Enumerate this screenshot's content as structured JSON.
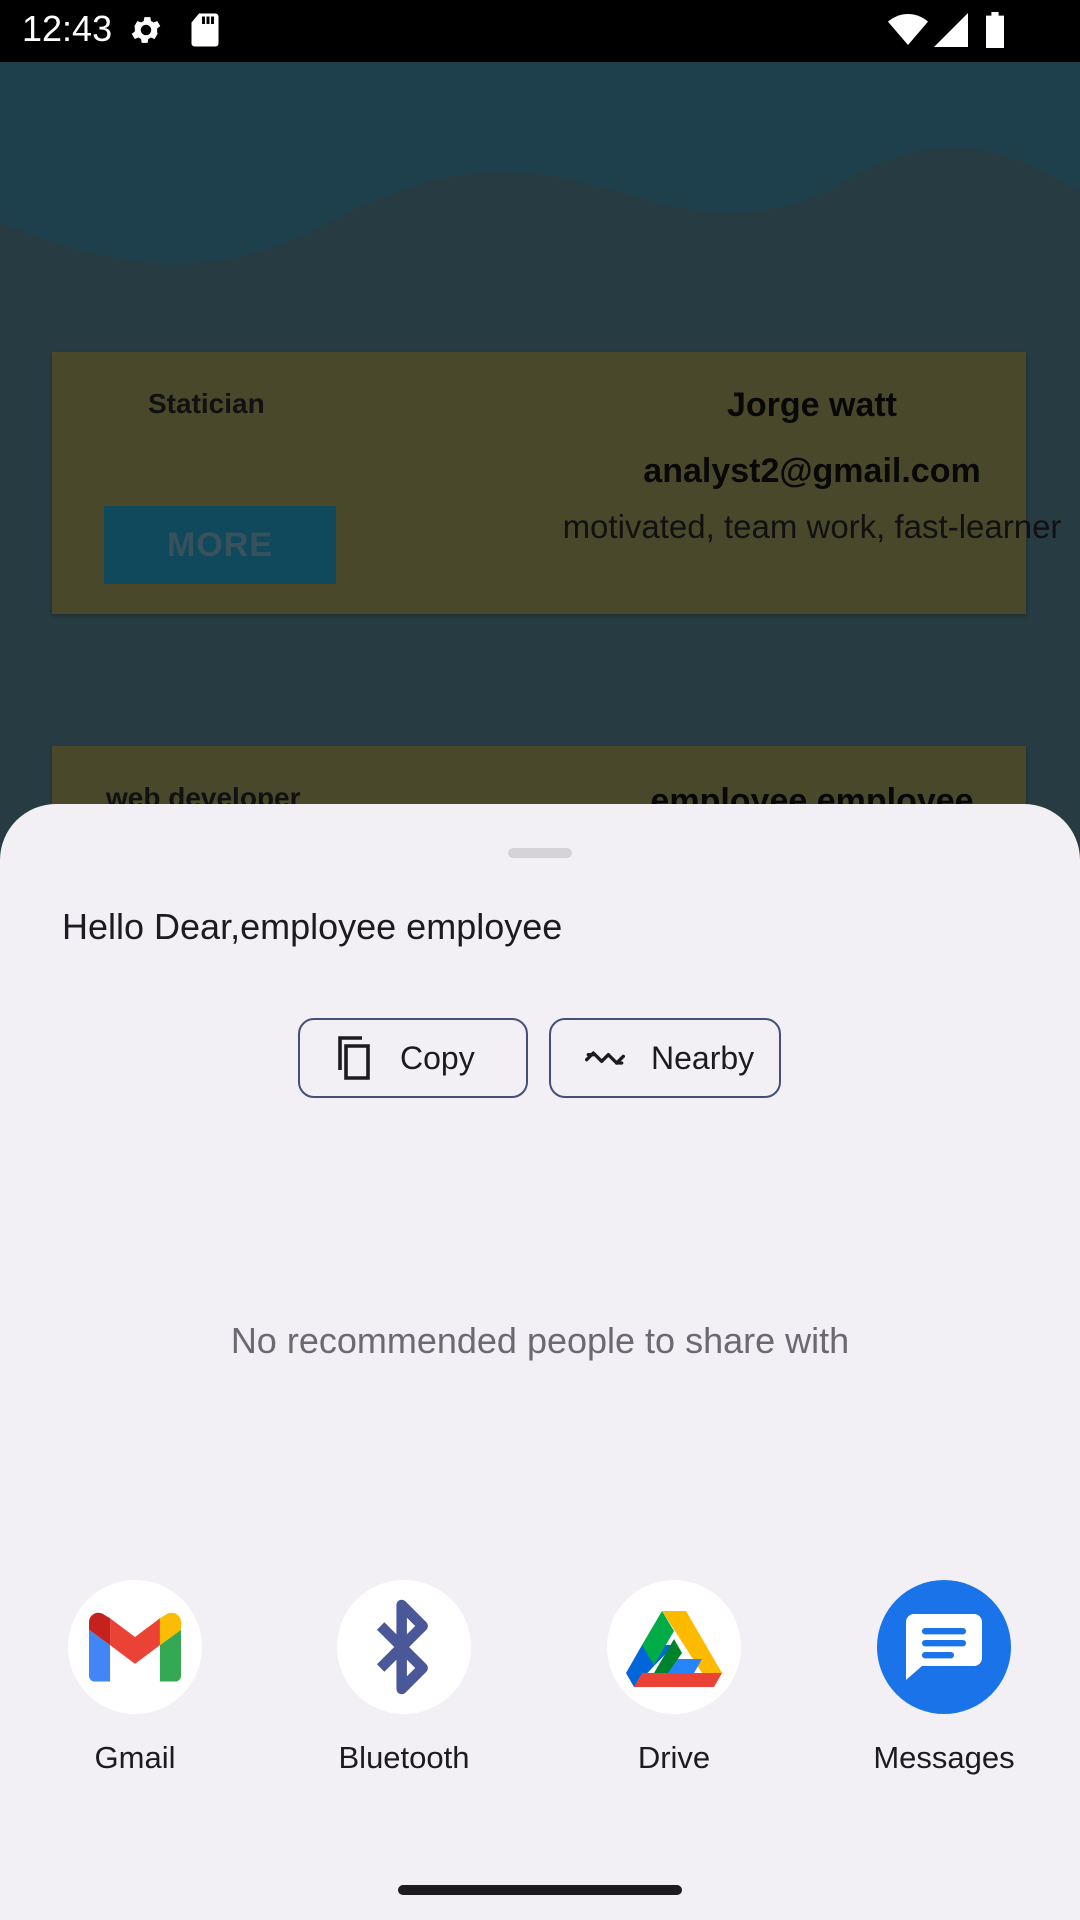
{
  "status_bar": {
    "time": "12:43",
    "icons": [
      "gear-icon",
      "sd-card-icon",
      "wifi-icon",
      "signal-icon",
      "battery-icon"
    ]
  },
  "background_app": {
    "cards": [
      {
        "job": "Statician",
        "name": "Jorge watt",
        "email": "analyst2@gmail.com",
        "skills": "motivated, team work, fast-learner",
        "more_label": "MORE"
      },
      {
        "job": "web developer",
        "name": "employee employee"
      }
    ]
  },
  "share_sheet": {
    "text": "Hello Dear,employee employee",
    "copy_label": "Copy",
    "nearby_label": "Nearby",
    "no_recommendations": "No recommended people to share with",
    "targets": [
      {
        "label": "Gmail",
        "icon": "gmail-icon"
      },
      {
        "label": "Bluetooth",
        "icon": "bluetooth-icon"
      },
      {
        "label": "Drive",
        "icon": "drive-icon"
      },
      {
        "label": "Messages",
        "icon": "messages-icon"
      }
    ]
  },
  "colors": {
    "sheet_background": "#f2eff5",
    "chip_border": "#44507a",
    "messages_blue": "#1a73e8"
  }
}
